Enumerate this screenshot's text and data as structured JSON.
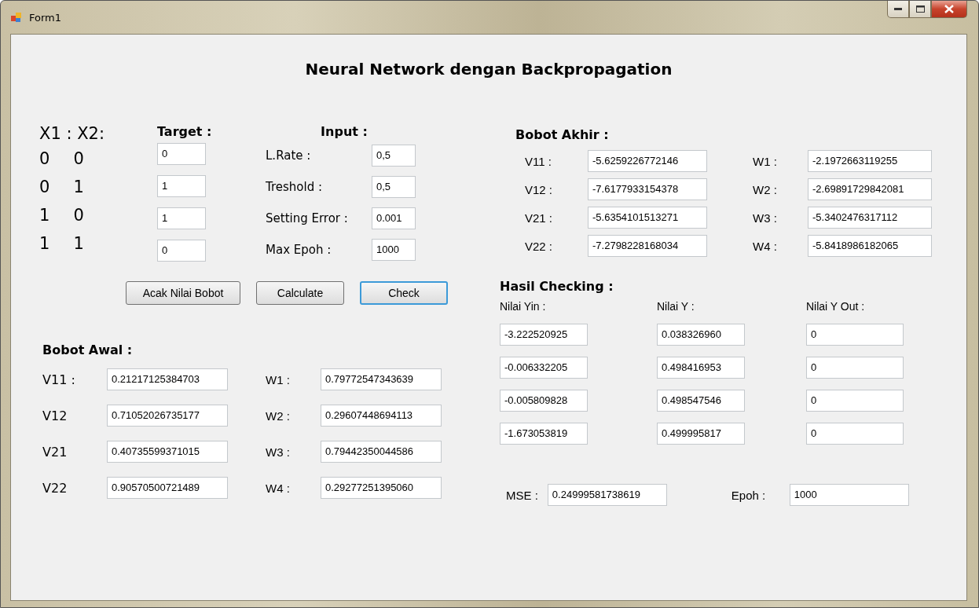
{
  "window": {
    "title": "Form1"
  },
  "heading": "Neural Network dengan Backpropagation",
  "xor_table": {
    "header": "X1 : X2:",
    "rows": [
      [
        "0",
        "0"
      ],
      [
        "0",
        "1"
      ],
      [
        "1",
        "0"
      ],
      [
        "1",
        "1"
      ]
    ]
  },
  "target": {
    "label": "Target :",
    "values": [
      "0",
      "1",
      "1",
      "0"
    ]
  },
  "input": {
    "label": "Input :",
    "params": [
      {
        "label": "L.Rate :",
        "value": "0,5"
      },
      {
        "label": "Treshold :",
        "value": "0,5"
      },
      {
        "label": "Setting Error :",
        "value": "0.001"
      },
      {
        "label": "Max Epoh :",
        "value": "1000"
      }
    ]
  },
  "buttons": [
    {
      "label": "Acak Nilai Bobot",
      "focused": false
    },
    {
      "label": "Calculate",
      "focused": false
    },
    {
      "label": "Check",
      "focused": true
    }
  ],
  "bobot_awal": {
    "label": "Bobot Awal :",
    "v": [
      {
        "label": "V11 :",
        "value": "0.21217125384703"
      },
      {
        "label": "V12",
        "value": "0.71052026735177"
      },
      {
        "label": "V21",
        "value": "0.40735599371015"
      },
      {
        "label": "V22",
        "value": "0.90570500721489"
      }
    ],
    "w": [
      {
        "label": "W1 :",
        "value": "0.79772547343639"
      },
      {
        "label": "W2 :",
        "value": "0.29607448694113"
      },
      {
        "label": "W3 :",
        "value": "0.79442350044586"
      },
      {
        "label": "W4 :",
        "value": "0.29277251395060"
      }
    ]
  },
  "bobot_akhir": {
    "label": "Bobot Akhir :",
    "v": [
      {
        "label": "V11 :",
        "value": "-5.6259226772146"
      },
      {
        "label": "V12 :",
        "value": "-7.6177933154378"
      },
      {
        "label": "V21 :",
        "value": "-5.6354101513271"
      },
      {
        "label": "V22 :",
        "value": "-7.2798228168034"
      }
    ],
    "w": [
      {
        "label": "W1 :",
        "value": "-2.1972663119255"
      },
      {
        "label": "W2 :",
        "value": "-2.69891729842081"
      },
      {
        "label": "W3 :",
        "value": "-5.3402476317112"
      },
      {
        "label": "W4 :",
        "value": "-5.8418986182065"
      }
    ]
  },
  "hasil_checking": {
    "label": "Hasil Checking :",
    "columns": [
      "Nilai Yin :",
      "Nilai Y :",
      "Nilai Y Out :"
    ],
    "rows": [
      [
        "-3.222520925",
        "0.038326960",
        "0"
      ],
      [
        "-0.006332205",
        "0.498416953",
        "0"
      ],
      [
        "-0.005809828",
        "0.498547546",
        "0"
      ],
      [
        "-1.673053819",
        "0.499995817",
        "0"
      ]
    ]
  },
  "mse": {
    "label": "MSE :",
    "value": "0.24999581738619"
  },
  "epoh": {
    "label": "Epoh :",
    "value": "1000"
  }
}
